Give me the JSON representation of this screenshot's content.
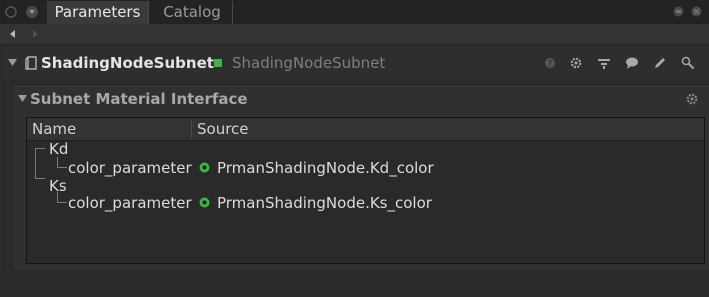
{
  "tabs": [
    {
      "label": "Parameters",
      "active": true
    },
    {
      "label": "Catalog",
      "active": false
    }
  ],
  "node": {
    "name": "ShadingNodeSubnet",
    "type": "ShadingNodeSubnet",
    "status_color": "#3db34a"
  },
  "group": {
    "title": "Subnet Material Interface"
  },
  "table": {
    "columns": [
      "Name",
      "Source"
    ],
    "rows": [
      {
        "name": "Kd",
        "source": "",
        "level": 0
      },
      {
        "name": "color_parameter",
        "source": "PrmanShadingNode.Kd_color",
        "level": 1
      },
      {
        "name": "Ks",
        "source": "",
        "level": 0
      },
      {
        "name": "color_parameter",
        "source": "PrmanShadingNode.Ks_color",
        "level": 1
      }
    ]
  },
  "icons": {
    "tab_menu": "menu-icon",
    "nav_back": "back-arrow-icon",
    "nav_forward": "forward-arrow-icon",
    "help": "help-icon",
    "settings": "gear-icon",
    "view": "view-icon",
    "comment": "comment-icon",
    "edit": "edit-icon",
    "search": "search-icon",
    "source_link": "link-icon"
  },
  "colors": {
    "accent_green": "#3db34a"
  }
}
